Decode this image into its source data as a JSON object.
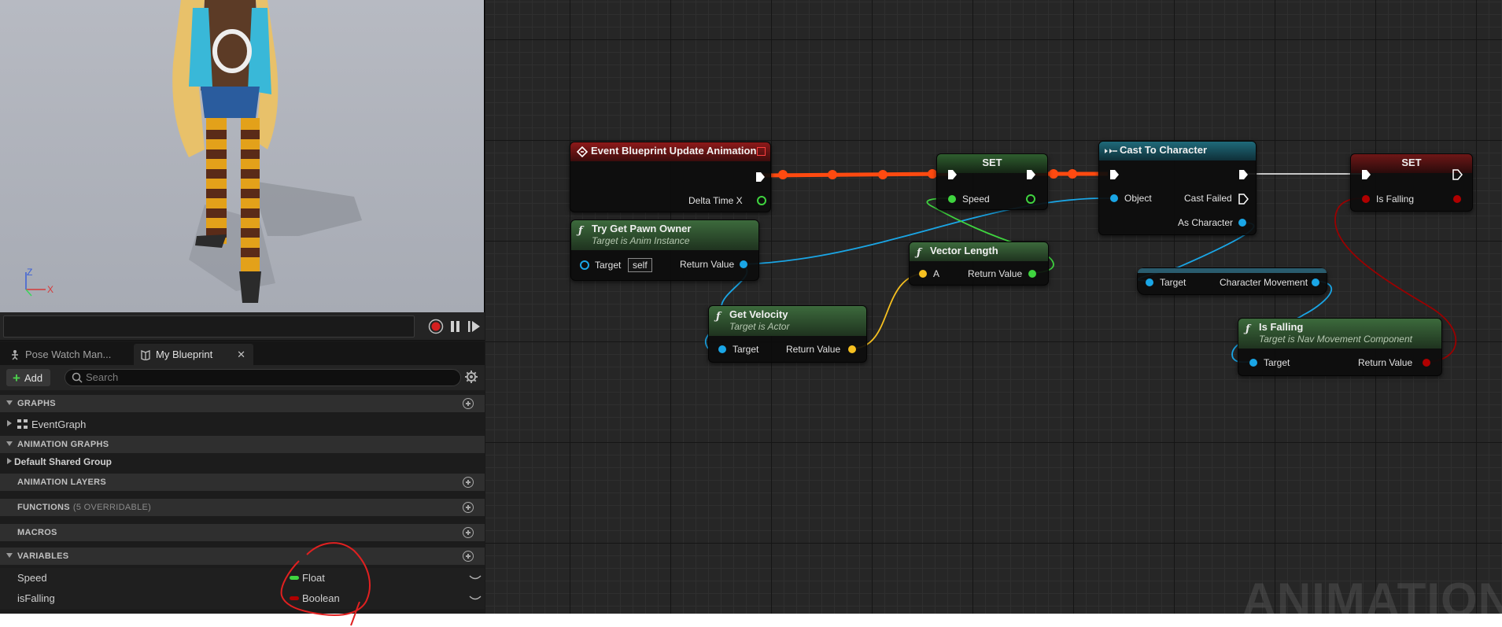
{
  "viewport": {
    "axis_z": "Z",
    "axis_x": "X"
  },
  "tabs": [
    {
      "label": "Pose Watch Man..."
    },
    {
      "label": "My Blueprint"
    }
  ],
  "toolbar": {
    "add_label": "Add",
    "search_placeholder": "Search"
  },
  "sections": {
    "graphs": "GRAPHS",
    "event_graph": "EventGraph",
    "animation_graphs": "ANIMATION GRAPHS",
    "default_shared_group": "Default Shared Group",
    "animation_layers": "ANIMATION LAYERS",
    "functions": "FUNCTIONS",
    "functions_sub": "(5 OVERRIDABLE)",
    "macros": "MACROS",
    "variables": "VARIABLES"
  },
  "variables": [
    {
      "name": "Speed",
      "type": "Float",
      "color": "#3fd43f"
    },
    {
      "name": "isFalling",
      "type": "Boolean",
      "color": "#9a0000"
    }
  ],
  "nodes": {
    "event_update": {
      "title": "Event Blueprint Update Animation",
      "pin_delta": "Delta Time X"
    },
    "try_get_pawn": {
      "title": "Try Get Pawn Owner",
      "subtitle": "Target is Anim Instance",
      "pin_target": "Target",
      "self": "self",
      "pin_return": "Return Value"
    },
    "set_speed": {
      "title": "SET",
      "pin": "Speed"
    },
    "vector_length": {
      "title": "Vector Length",
      "pin_a": "A",
      "pin_return": "Return Value"
    },
    "get_velocity": {
      "title": "Get Velocity",
      "subtitle": "Target is Actor",
      "pin_target": "Target",
      "pin_return": "Return Value"
    },
    "cast": {
      "title": "Cast To Character",
      "pin_object": "Object",
      "pin_failed": "Cast Failed",
      "pin_as": "As Character"
    },
    "char_movement": {
      "pin_target": "Target",
      "pin_out": "Character Movement"
    },
    "set_falling": {
      "title": "SET",
      "pin": "Is Falling"
    },
    "is_falling": {
      "title": "Is Falling",
      "subtitle": "Target is Nav Movement Component",
      "pin_target": "Target",
      "pin_return": "Return Value"
    }
  },
  "watermark": "ANIMATION",
  "colors": {
    "exec_wire": "#ff4a10",
    "object_pin": "#1aa6e6",
    "float_pin": "#3fd43f",
    "vector_pin": "#f6c020",
    "bool_pin": "#9a0000",
    "annotation": "#e02020"
  }
}
